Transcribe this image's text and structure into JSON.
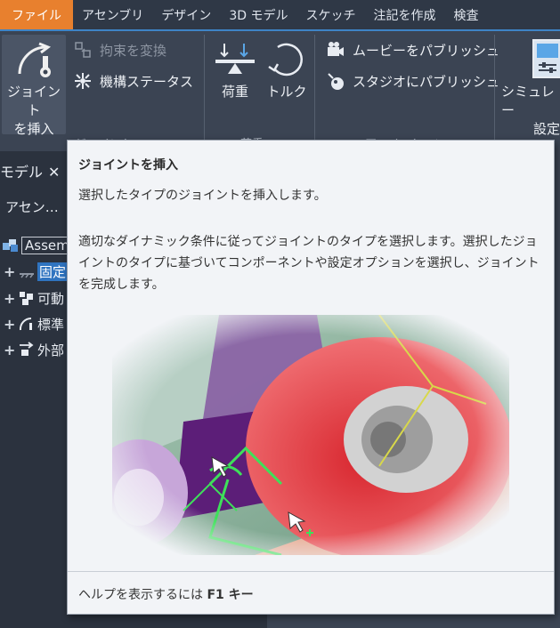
{
  "menubar": {
    "items": [
      {
        "label": "ファイル",
        "active": true
      },
      {
        "label": "アセンブリ",
        "active": false
      },
      {
        "label": "デザイン",
        "active": false
      },
      {
        "label": "3D モデル",
        "active": false
      },
      {
        "label": "スケッチ",
        "active": false
      },
      {
        "label": "注記を作成",
        "active": false
      },
      {
        "label": "検査",
        "active": false
      }
    ]
  },
  "ribbon": {
    "insert_joint": {
      "line1": "ジョイント",
      "line2": "を挿入"
    },
    "convert_constraint": "拘束を変換",
    "mechanism_status": "機構ステータス",
    "group_joint": "ジョイント",
    "load": "荷重",
    "torque": "トルク",
    "group_load": "荷重",
    "publish_movie": "ムービーをパブリッシュ",
    "publish_studio": "スタジオにパブリッシュ",
    "group_publish": "アニメーション",
    "sim_settings": {
      "line1": "シミュレー",
      "line2": "設定"
    }
  },
  "browser": {
    "title": "モデル",
    "close_glyph": "✕",
    "dropdown": "アセン…",
    "tree": [
      {
        "label": "Assem",
        "expand": ""
      },
      {
        "label": "固定",
        "expand": "+"
      },
      {
        "label": "可動",
        "expand": "+"
      },
      {
        "label": "標準",
        "expand": "+"
      },
      {
        "label": "外部",
        "expand": "+"
      }
    ]
  },
  "tooltip": {
    "title": "ジョイントを挿入",
    "description": "選択したタイプのジョイントを挿入します。",
    "body": "適切なダイナミック条件に従ってジョイントのタイプを選択します。選択したジョイントのタイプに基づいてコンポーネントや設定オプションを選択し、ジョイントを完成します。",
    "help_prefix": "ヘルプを表示するには ",
    "help_key": "F1 キー"
  },
  "colors": {
    "accent_orange": "#e8802e",
    "selection_blue": "#2f74c0",
    "ribbon_bg": "#3b4453",
    "menubar_bg": "#2f3846"
  }
}
